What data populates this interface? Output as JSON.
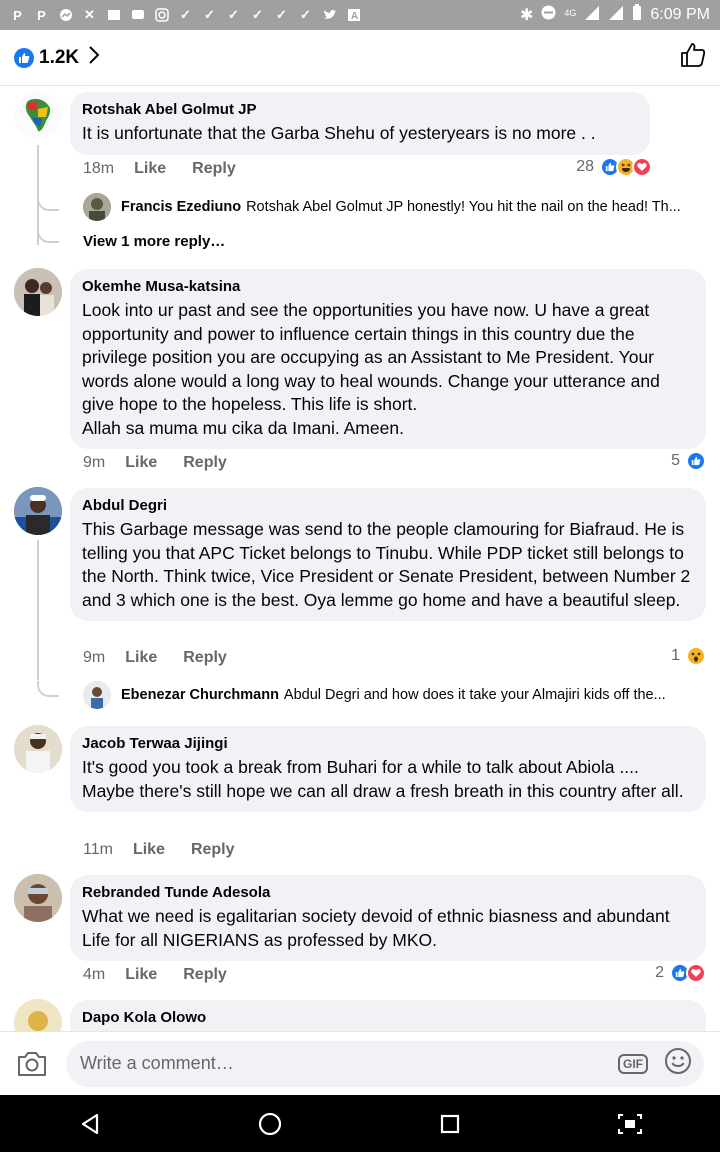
{
  "status_bar": {
    "time": "6:09 PM",
    "network": "4G",
    "notification_icons": [
      "p-icon",
      "p-icon",
      "messenger-icon",
      "bird-icon",
      "image-icon",
      "chat-icon",
      "instagram-icon",
      "check-icon",
      "check-icon",
      "check-icon",
      "check-icon",
      "check-icon",
      "check-icon",
      "twitter-icon",
      "a-icon"
    ]
  },
  "header": {
    "reaction_count": "1.2K",
    "chevron_icon": "chevron-right-icon",
    "like_icon": "thumbs-up-icon"
  },
  "comments": [
    {
      "name": "Rotshak Abel Golmut JP",
      "text": "It is unfortunate that the Garba Shehu of yesteryears is no more . .",
      "time": "18m",
      "like_label": "Like",
      "reply_label": "Reply",
      "reaction_count": "28",
      "reactions": [
        "like",
        "haha",
        "love"
      ],
      "replies": [
        {
          "name": "Francis Ezediuno",
          "text": "Rotshak Abel Golmut JP honestly! You hit the nail on the head! Th..."
        }
      ],
      "more_replies": "View 1 more reply…"
    },
    {
      "name": "Okemhe Musa-katsina",
      "text": "Look into ur past and see the opportunities you have now. U have a great opportunity and power to influence certain things in this country due the privilege position you are occupying as an Assistant to Me President. Your words alone would a long way to heal wounds. Change your utterance and give hope to the hopeless. This life is short.\nAllah sa muma mu cika da Imani. Ameen.",
      "time": "9m",
      "like_label": "Like",
      "reply_label": "Reply",
      "reaction_count": "5",
      "reactions": [
        "like"
      ]
    },
    {
      "name": "Abdul Degri",
      "text": "This Garbage message was send to the people clamouring for Biafraud. He is telling you that APC Ticket belongs to Tinubu. While PDP ticket still belongs to the North. Think twice, Vice President or Senate President, between Number 2 and 3 which one is the best. Oya lemme go home and have a beautiful sleep.",
      "time": "9m",
      "like_label": "Like",
      "reply_label": "Reply",
      "reaction_count": "1",
      "reactions": [
        "wow"
      ],
      "replies": [
        {
          "name": "Ebenezar Churchmann",
          "text": "Abdul Degri and how does it take your Almajiri kids off the..."
        }
      ]
    },
    {
      "name": "Jacob Terwaa Jijingi",
      "text": "It's good you took a break from Buhari for a while to talk about Abiola .... Maybe there's still hope we can all draw a fresh breath in this country after all.",
      "time": "11m",
      "like_label": "Like",
      "reply_label": "Reply"
    },
    {
      "name": "Rebranded Tunde Adesola",
      "text": "What we need is egalitarian society devoid of ethnic biasness and abundant Life for all NIGERIANS as professed by MKO.",
      "time": "4m",
      "like_label": "Like",
      "reply_label": "Reply",
      "reaction_count": "2",
      "reactions": [
        "like",
        "love"
      ]
    },
    {
      "name": "Dapo Kola Olowo"
    }
  ],
  "composer": {
    "placeholder": "Write a comment…",
    "camera_icon": "camera-icon",
    "gif_label": "GIF",
    "emoji_icon": "smiley-icon"
  },
  "colors": {
    "accent": "#1877f2",
    "bubble": "#f0f2f5",
    "love": "#f33e58",
    "haha": "#f7b125",
    "secondary_text": "#65676b"
  }
}
